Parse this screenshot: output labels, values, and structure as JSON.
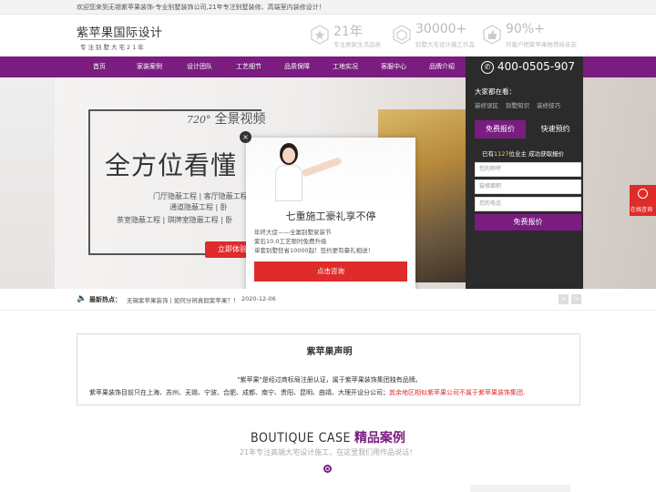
{
  "topbar": {
    "text": "欢迎您来到无锡紫苹果装饰-专业别墅装饰公司,21年专注别墅装修、高端室内装修设计！"
  },
  "logo": {
    "name": "紫苹果国际设计",
    "tagline": "专注别墅大宅21年"
  },
  "stats": [
    {
      "num": "21年",
      "cap": "专注居家生活品质"
    },
    {
      "num": "30000+",
      "cap": "别墅大宅设计施工作品"
    },
    {
      "num": "90%+",
      "cap": "的客户把紫苹果推荐给亲友"
    }
  ],
  "nav": [
    "首页",
    "家装案例",
    "设计团队",
    "工艺细节",
    "品质保障",
    "工地实况",
    "客服中心",
    "品牌介绍"
  ],
  "hero": {
    "vr_logo": "720°",
    "vr_label": "全景视频",
    "title": "全方位看懂",
    "lines": [
      "门厅隐蔽工程  |  客厅隐蔽工程  |  餐",
      "通道隐蔽工程  |  卧",
      "茶室隐蔽工程  |  琪牌室隐蔽工程  |  卧"
    ],
    "button": "立即体验"
  },
  "sidebox": {
    "phone": "400-0505-907",
    "heading": "大家都在看：",
    "links": [
      "装修误区",
      "别墅知识",
      "装修技巧"
    ],
    "tab_active": "免费报价",
    "tab_other": "快速预约",
    "count_prefix": "已有",
    "count": "1127",
    "count_suffix": "位业主 成功获取报价",
    "placeholders": [
      "您的称呼",
      "装修面积",
      "您的电话"
    ],
    "submit": "免费报价"
  },
  "popup": {
    "close": "×",
    "title": "七重施工豪礼享不停",
    "lines": [
      "年终大促——全案别墅家装节",
      "紫石10.0工艺限时免费升级",
      "单套别墅狂省10000起！签约更有豪礼相送！"
    ],
    "button": "点击咨询"
  },
  "ticker": {
    "icon": "🔈",
    "label": "最新热点：",
    "text": "无锡紫苹果装饰 | 如何分辨真假紫苹果？！",
    "date": "2020-12-06",
    "prev": "<",
    "next": ">"
  },
  "statement": {
    "title": "紫苹果声明",
    "line1": "\"紫苹果\"是经过商标局注册认证，属于紫苹果装饰集团独有品牌。",
    "line2a": "紫苹果装饰目前只在上海、苏州、无锡、宁波、合肥、成都、南宁、贵阳、昆明、曲靖、大理开设分公司；",
    "line2b": "其余地区相似紫苹果公司不属于紫苹果装饰集团."
  },
  "boutique": {
    "en": "BOUTIQUE CASE",
    "cn": "精品案例",
    "sub": "21年专注高端大宅设计施工，在这里我们用作品说话！"
  },
  "float": {
    "label": "在线咨询"
  },
  "colors": {
    "brand": "#7a1c80",
    "accent": "#e02b2b",
    "dark": "#2b2b2b"
  }
}
